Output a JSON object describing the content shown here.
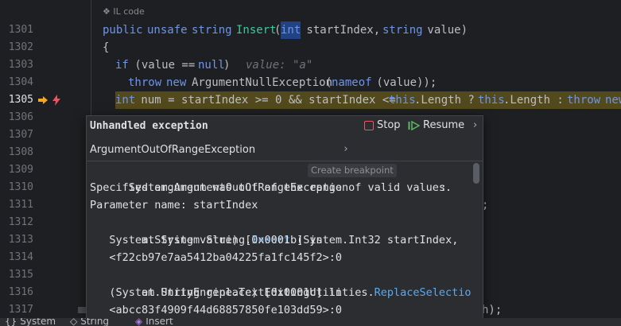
{
  "editor": {
    "il_code_label": "IL code",
    "line_numbers": [
      "1301",
      "1302",
      "1303",
      "1304",
      "1305",
      "1306",
      "1307",
      "1308",
      "1309",
      "1310",
      "1311",
      "1312",
      "1313",
      "1314",
      "1315",
      "1316",
      "1317"
    ],
    "current_line": "1305",
    "lines": {
      "l1301": {
        "kw1": "public",
        "kw2": "unsafe",
        "kw3": "string",
        "fn": "Insert",
        "p1": "(",
        "kw4": "int",
        "p2": " startIndex, ",
        "kw5": "string",
        "p3": " value)"
      },
      "l1302": {
        "text": "{"
      },
      "l1303": {
        "kw": "if",
        "p": " (value == ",
        "kw2": "null",
        "p2": ")",
        "hint": "value: \"a\""
      },
      "l1304": {
        "kw": "throw",
        "kw2": "new",
        "ty": "ArgumentNullException",
        "p1": "(",
        "kw3": "nameof",
        "p2": " (value));"
      },
      "l1305": {
        "kw1": "int",
        "p1": " num = startIndex >= 0 && startIndex <= ",
        "kw2": "this",
        "p2": ".Length ? ",
        "kw3": "this",
        "p3": ".Length : ",
        "kw4": "throw",
        "kw5": "new"
      },
      "l1311_tail": ";",
      "l1317_tail": "h);"
    }
  },
  "popup": {
    "title": "Unhandled exception",
    "stop_label": "Stop",
    "resume_label": "Resume",
    "more_label": "›",
    "exception_type": "ArgumentOutOfRangeException",
    "expand_label": "›",
    "create_breakpoint": "Create breakpoint",
    "stack": {
      "s1_a": "System.",
      "s1_b": "ArgumentOutOfRangeException",
      "s1_c": ":",
      "s2": "Specified argument was out of the range of valid values.",
      "s3": "Parameter name: startIndex",
      "s4_a": "  at System.String.",
      "s4_b": "Insert",
      "s4_c": " (System.Int32 startIndex,",
      "s5": "   System.String value) [0x0001b] in",
      "s6": "   <f22cb97e7aa5412ba04225fa1fc145f2>:0",
      "s7_a": "  at UnityEngine.TextEditingUtilities.",
      "s7_b": "ReplaceSelection",
      "s8": "   (System.String replace) [0x0001c] in",
      "s9": "   <abcc83f4909f44d68857850fe103dd59>:0"
    }
  },
  "statusbar": {
    "crumb1": "System",
    "crumb2": "String",
    "crumb3": "Insert"
  },
  "colors": {
    "background": "#1e1f22",
    "keyword": "#6c95eb",
    "method": "#39cc9b",
    "execution_line": "#524a1c",
    "stop": "#e55765",
    "resume": "#5fb865"
  }
}
